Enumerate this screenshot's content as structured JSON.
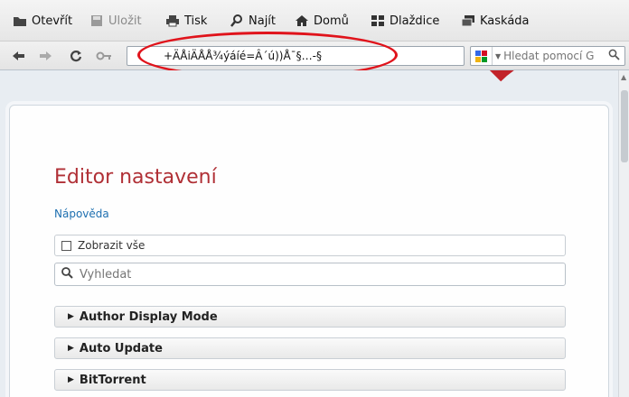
{
  "toolbar": {
    "open": "Otevřít",
    "save": "Uložit",
    "print": "Tisk",
    "find": "Najít",
    "home": "Domů",
    "tile": "Dlaždice",
    "cascade": "Kaskáda"
  },
  "navbar": {
    "address_value": "+ÄÅiÄÅÅ¾ýáíé=Â´ú))Å¯§…-§",
    "search_placeholder": "Hledat pomocí G",
    "annotation_color": "#e0131b"
  },
  "page": {
    "title": "Editor nastavení",
    "help": "Nápověda",
    "show_all": "Zobrazit vše",
    "filter_placeholder": "Vyhledat",
    "sections": [
      "Author Display Mode",
      "Auto Update",
      "BitTorrent"
    ]
  },
  "colors": {
    "title": "#b03036",
    "link": "#1d6fb0",
    "brand_red": "#c0181f"
  }
}
